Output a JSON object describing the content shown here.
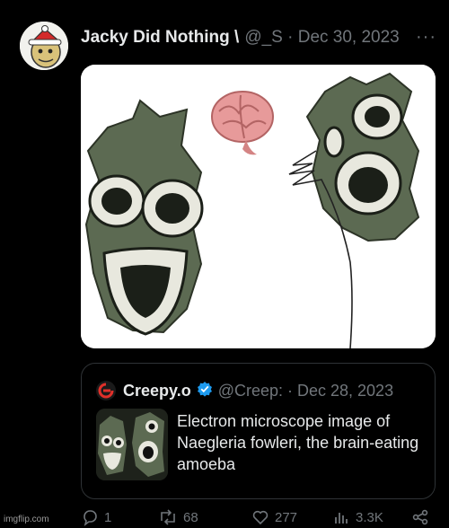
{
  "post": {
    "author_name": "Jacky Did Nothing \\",
    "author_meta": "@_S · Dec 30, 2023",
    "more_label": "···"
  },
  "quote": {
    "name": "Creepy.o",
    "meta": "@Creep: · Dec 28, 2023",
    "text": "Electron microscope image of Naegleria fowleri, the brain-eating amoeba"
  },
  "actions": {
    "replies": "1",
    "reposts": "68",
    "likes": "277",
    "views": "3.3K"
  },
  "watermark": "imgflip.com",
  "colors": {
    "background": "#000000",
    "text": "#e7e9ea",
    "muted": "#71767b",
    "border": "#2f3336",
    "verified": "#1d9bf0",
    "brain": "#e79a9a"
  },
  "icons": [
    "more-icon",
    "verified-icon",
    "reply-icon",
    "repost-icon",
    "like-icon",
    "views-icon",
    "share-icon"
  ]
}
